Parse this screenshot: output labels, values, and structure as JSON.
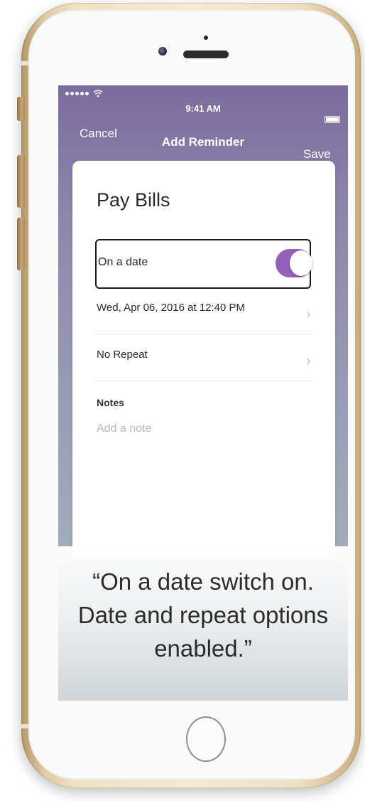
{
  "status_bar": {
    "time": "9:41 AM",
    "signal_icon": "signal-dots-icon",
    "wifi_icon": "wifi-icon",
    "battery_icon": "battery-icon"
  },
  "nav": {
    "cancel_label": "Cancel",
    "title": "Add Reminder",
    "save_label": "Save"
  },
  "reminder": {
    "title": "Pay Bills",
    "on_a_date": {
      "label": "On a date",
      "switch_on": true
    },
    "date_row": {
      "label": "Wed, Apr 06, 2016 at 12:40 PM",
      "chevron": "›"
    },
    "repeat_row": {
      "label": "No Repeat",
      "chevron": "›"
    },
    "notes": {
      "label": "Notes",
      "placeholder": "Add a note"
    }
  },
  "caption": {
    "text": "“On a date switch on. Date and repeat options enabled.”"
  },
  "colors": {
    "switch_on": "#9462b9",
    "header_gradient_top": "#7b6b9e",
    "frame_gold": "#e2cda4"
  }
}
